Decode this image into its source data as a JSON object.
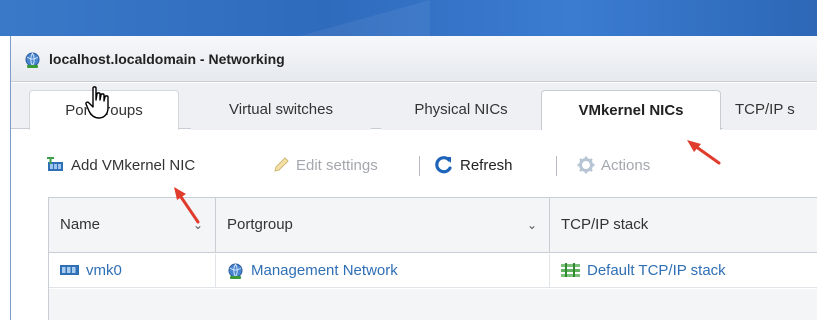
{
  "window": {
    "title": "localhost.localdomain - Networking"
  },
  "tabs": [
    {
      "label": "Port groups",
      "active": false
    },
    {
      "label": "Virtual switches",
      "active": false
    },
    {
      "label": "Physical NICs",
      "active": false
    },
    {
      "label": "VMkernel NICs",
      "active": true
    },
    {
      "label": "TCP/IP s",
      "active": false
    }
  ],
  "toolbar": {
    "add_label": "Add VMkernel NIC",
    "edit_label": "Edit settings",
    "refresh_label": "Refresh",
    "actions_label": "Actions"
  },
  "grid": {
    "columns": [
      "Name",
      "Portgroup",
      "TCP/IP stack"
    ],
    "rows": [
      {
        "name": "vmk0",
        "portgroup": "Management Network",
        "stack": "Default TCP/IP stack"
      }
    ]
  },
  "colors": {
    "link": "#2f6fb5",
    "annotation_arrow": "#e03c2e",
    "header_strip": "#3a78c8"
  },
  "icons": {
    "title": "network-globe-icon",
    "add": "add-nic-icon",
    "edit": "pencil-icon",
    "refresh": "refresh-icon",
    "actions": "gear-icon",
    "nic": "vmkernel-nic-icon",
    "portgroup": "network-globe-icon",
    "stack": "tcpip-stack-icon"
  }
}
